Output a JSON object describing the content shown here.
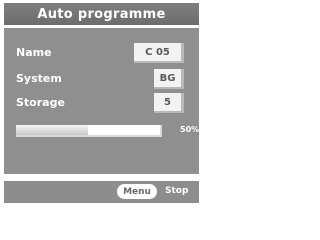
{
  "title": "Auto programme",
  "fields": [
    {
      "label": "Name",
      "value": "C 05"
    },
    {
      "label": "System",
      "value": "BG"
    },
    {
      "label": "Storage",
      "value": "5"
    }
  ],
  "progress": {
    "percent": 50,
    "label": "50%"
  },
  "footer": {
    "menu_button": "Menu",
    "stop_label": "Stop"
  },
  "colors": {
    "panel": "#8f8f8f",
    "title_bar": "#757575",
    "value_box": "#f2f2f2"
  }
}
